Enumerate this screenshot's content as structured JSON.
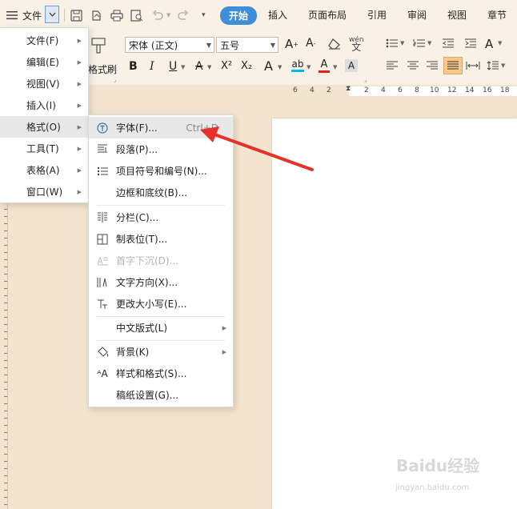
{
  "topbar": {
    "menu_label": "文件",
    "tabs": [
      {
        "label": "开始",
        "active": true
      },
      {
        "label": "插入"
      },
      {
        "label": "页面布局"
      },
      {
        "label": "引用"
      },
      {
        "label": "审阅"
      },
      {
        "label": "视图"
      },
      {
        "label": "章节"
      }
    ]
  },
  "ribbon": {
    "format_painter_label": "格式刷",
    "font_name": "宋体 (正文)",
    "font_size": "五号",
    "bold": "B",
    "italic": "I",
    "underline": "U",
    "strike": "A",
    "superscript": "X²",
    "subscript": "X₂",
    "wen_label": "wén",
    "accent_color": "#3f8fd8",
    "highlight_color": "#00b8e6",
    "font_color": "#e02020"
  },
  "ruler": {
    "numbers": [
      "6",
      "4",
      "2",
      "2",
      "4",
      "6",
      "8",
      "10",
      "12",
      "14",
      "16",
      "18"
    ]
  },
  "main_menu": {
    "items": [
      {
        "label": "文件(F)",
        "has_sub": true
      },
      {
        "label": "编辑(E)",
        "has_sub": true
      },
      {
        "label": "视图(V)",
        "has_sub": true
      },
      {
        "label": "插入(I)",
        "has_sub": true
      },
      {
        "label": "格式(O)",
        "has_sub": true,
        "highlighted": true
      },
      {
        "label": "工具(T)",
        "has_sub": true
      },
      {
        "label": "表格(A)",
        "has_sub": true
      },
      {
        "label": "窗口(W)",
        "has_sub": true
      }
    ]
  },
  "format_menu": {
    "items": [
      {
        "label": "字体(F)...",
        "shortcut": "Ctrl+D",
        "icon": "font-icon",
        "highlighted": true
      },
      {
        "label": "段落(P)...",
        "icon": "paragraph-icon"
      },
      {
        "label": "项目符号和编号(N)...",
        "icon": "bullet-list-icon"
      },
      {
        "label": "边框和底纹(B)...",
        "icon": ""
      },
      {
        "label": "分栏(C)...",
        "icon": "columns-icon"
      },
      {
        "label": "制表位(T)...",
        "icon": "tab-stop-icon"
      },
      {
        "label": "首字下沉(D)...",
        "icon": "drop-cap-icon",
        "disabled": true
      },
      {
        "label": "文字方向(X)...",
        "icon": "text-direction-icon"
      },
      {
        "label": "更改大小写(E)...",
        "icon": "change-case-icon"
      },
      {
        "label": "中文版式(L)",
        "icon": "",
        "has_sub": true
      },
      {
        "label": "背景(K)",
        "icon": "background-icon",
        "has_sub": true
      },
      {
        "label": "样式和格式(S)...",
        "icon": "styles-icon"
      },
      {
        "label": "稿纸设置(G)...",
        "icon": ""
      }
    ]
  },
  "watermark": {
    "main": "Baidu经验",
    "sub": "jingyan.baidu.com"
  },
  "arrow_color": "#e8302a"
}
